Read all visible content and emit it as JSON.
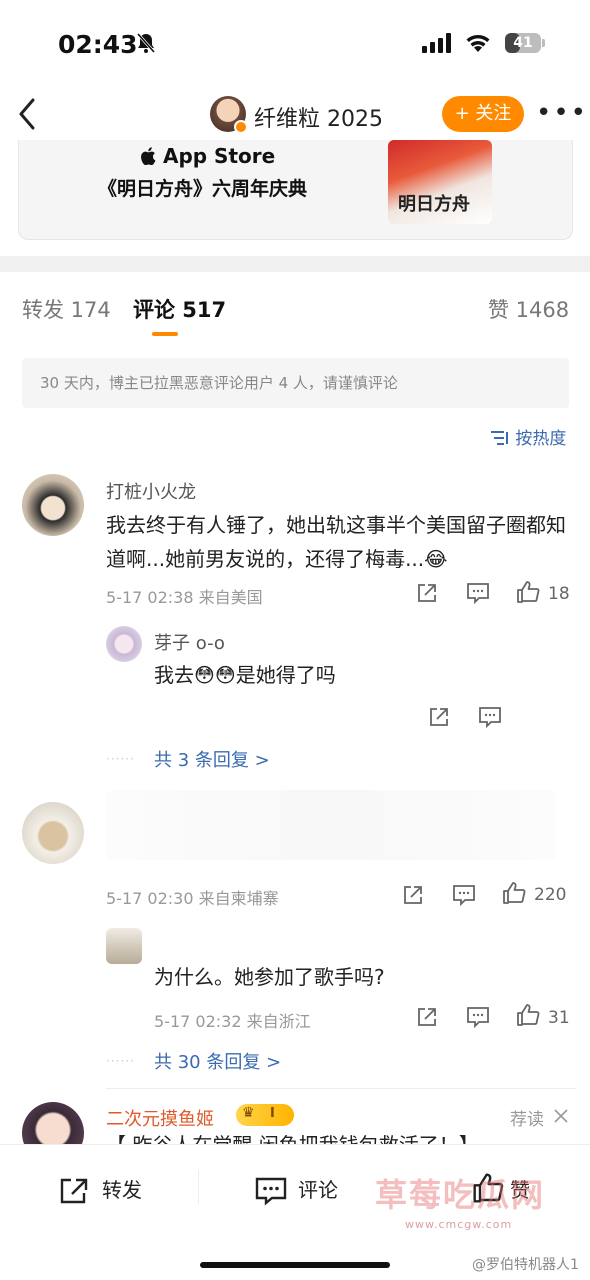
{
  "status": {
    "time": "02:43",
    "battery": "41",
    "battery_level": 0.41
  },
  "nav": {
    "username": "纤维粒 2025",
    "follow_label": "+ 关注",
    "more_label": "•••"
  },
  "card": {
    "store_label": "App Store",
    "title": "《明日方舟》六周年庆典",
    "image_text": "明日方舟"
  },
  "tabs": [
    {
      "label": "转发 174"
    },
    {
      "label": "评论 517"
    },
    {
      "label": "赞 1468"
    }
  ],
  "notice": "30 天内，博主已拉黑恶意评论用户 4 人，请谨慎评论",
  "sort_label": "按热度",
  "comments": [
    {
      "user": "打桩小火龙",
      "text": "我去终于有人锤了，她出轨这事半个美国留子圈都知道啊...她前男友说的，还得了梅毒...",
      "meta": "5-17 02:38  来自美国",
      "likes": "18",
      "reply": {
        "user": "芽子 o-o",
        "text": "我去",
        "text_after": "是她得了吗"
      },
      "reply_link": "共 3 条回复 >"
    },
    {
      "user": "",
      "text": "",
      "meta": "5-17 02:30  来自柬埔寨",
      "likes": "220",
      "reply": {
        "user": "",
        "text": "为什么。她参加了歌手吗?",
        "meta": "5-17 02:32  来自浙江",
        "likes": "31"
      },
      "reply_link": "共 30 条回复 >"
    },
    {
      "user": "二次元摸鱼姬",
      "badge": "I",
      "tag": "荐读",
      "text": "【 昨谷人在觉醒 闲鱼把我钱包救活了！】"
    }
  ],
  "bottom_bar": {
    "repost": "转发",
    "comment": "评论",
    "like": "赞"
  },
  "watermark": {
    "main": "草莓吃瓜网",
    "sub": "www.cmcgw.com",
    "credit": "@罗伯特机器人1"
  },
  "colors": {
    "accent": "#ff8a00",
    "link": "#3a6bb0"
  }
}
